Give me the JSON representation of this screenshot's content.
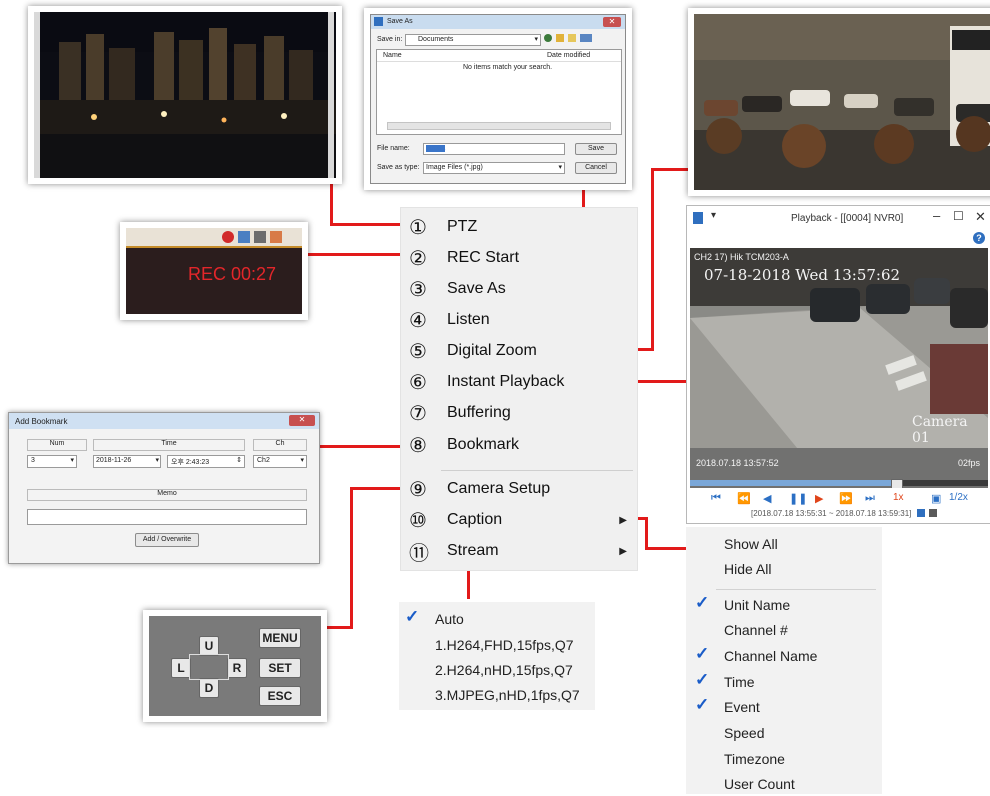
{
  "menu": {
    "items": [
      {
        "num": "①",
        "label": "PTZ"
      },
      {
        "num": "②",
        "label": "REC Start"
      },
      {
        "num": "③",
        "label": "Save As"
      },
      {
        "num": "④",
        "label": "Listen"
      },
      {
        "num": "⑤",
        "label": "Digital Zoom"
      },
      {
        "num": "⑥",
        "label": "Instant Playback"
      },
      {
        "num": "⑦",
        "label": "Buffering"
      },
      {
        "num": "⑧",
        "label": "Bookmark"
      },
      {
        "num": "⑨",
        "label": "Camera Setup"
      },
      {
        "num": "⑩",
        "label": "Caption"
      },
      {
        "num": "⑪",
        "label": "Stream"
      }
    ]
  },
  "stream_menu": {
    "items": [
      {
        "label": "Auto",
        "checked": true
      },
      {
        "label": "1.H264,FHD,15fps,Q7",
        "checked": false
      },
      {
        "label": "2.H264,nHD,15fps,Q7",
        "checked": false
      },
      {
        "label": "3.MJPEG,nHD,1fps,Q7",
        "checked": false
      }
    ]
  },
  "caption_menu": {
    "items": [
      {
        "label": "Show All",
        "checked": false
      },
      {
        "label": "Hide All",
        "checked": false
      },
      {
        "label": "Unit Name",
        "checked": true
      },
      {
        "label": "Channel #",
        "checked": false
      },
      {
        "label": "Channel Name",
        "checked": true
      },
      {
        "label": "Time",
        "checked": true
      },
      {
        "label": "Event",
        "checked": true
      },
      {
        "label": "Speed",
        "checked": false
      },
      {
        "label": "Timezone",
        "checked": false
      },
      {
        "label": "User Count",
        "checked": false
      }
    ]
  },
  "rec_overlay": {
    "text": "REC 00:27"
  },
  "save_as": {
    "title": "Save As",
    "save_in_label": "Save in:",
    "save_in_value": "Documents",
    "col_name": "Name",
    "col_date": "Date modified",
    "empty_msg": "No items match your search.",
    "file_name_label": "File name:",
    "file_name_value": "00001",
    "save_type_label": "Save as type:",
    "save_type_value": "Image Files (*.jpg)",
    "save_btn": "Save",
    "cancel_btn": "Cancel"
  },
  "playback": {
    "title": "Playback - [[0004] NVR0]",
    "channel_osd": "CH2 17) Hik TCM203-A",
    "date_osd": "07-18-2018 Wed 13:57:62",
    "camera_osd": "Camera 01",
    "bottom_osd_left": "2018.07.18 13:57:52",
    "bottom_osd_right": "02fps",
    "speed": "1x",
    "speed_half": "1/2x",
    "range": "[2018.07.18 13:55:31 ~ 2018.07.18 13:59:31]",
    "progress": 0.69
  },
  "keypad": {
    "up": "U",
    "down": "D",
    "left": "L",
    "right": "R",
    "menu": "MENU",
    "set": "SET",
    "esc": "ESC"
  },
  "bookmark": {
    "title": "Add Bookmark",
    "num_label": "Num",
    "time_label": "Time",
    "ch_label": "Ch",
    "num_value": "3",
    "date_value": "2018-11-26",
    "time_value": "오후  2:43:23",
    "ch_value": "Ch2",
    "memo_label": "Memo",
    "add_btn": "Add / Overwrite"
  },
  "colors": {
    "connector": "#e21a1a",
    "check": "#1a5cc8",
    "menu_bg": "#f0f0f0",
    "rec_text": "#e3262a"
  }
}
